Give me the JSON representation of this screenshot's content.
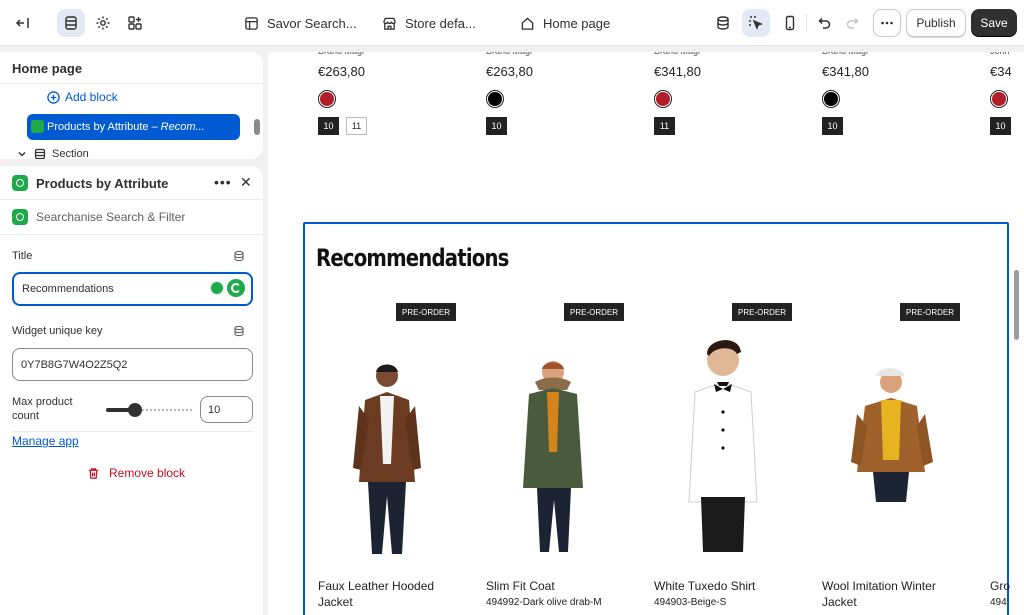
{
  "topbar": {
    "store_context": "Savor Search...",
    "theme_context": "Store defa...",
    "page_context": "Home page",
    "publish_label": "Publish",
    "save_label": "Save"
  },
  "tree": {
    "title": "Home page",
    "add_block": "Add block",
    "selected_block": "Products by Attribute",
    "selected_block_suffix": "– Recom...",
    "section_label": "Section"
  },
  "block_panel": {
    "title": "Products by Attribute",
    "app_name": "Searchanise Search & Filter",
    "title_label": "Title",
    "title_value": "Recommendations",
    "key_label": "Widget unique key",
    "key_value": "0Y7B8G7W4O2Z5Q2",
    "max_label": "Max product count",
    "max_value": "10",
    "max_level_fraction": 0.26,
    "manage_app": "Manage app",
    "remove_block": "Remove block"
  },
  "canvas": {
    "top_products": [
      {
        "brand": "Brand Magi",
        "price": "€263,80",
        "swatch": "#b1202a",
        "sizes": [
          {
            "label": "10",
            "style": "dark"
          },
          {
            "label": "11",
            "style": "light"
          }
        ]
      },
      {
        "brand": "Brand Magi",
        "price": "€263,80",
        "swatch": "#000000",
        "sizes": [
          {
            "label": "10",
            "style": "dark"
          }
        ]
      },
      {
        "brand": "Brand Magi",
        "price": "€341,80",
        "swatch": "#b1202a",
        "sizes": [
          {
            "label": "11",
            "style": "dark"
          }
        ]
      },
      {
        "brand": "Brand Magi",
        "price": "€341,80",
        "swatch": "#000000",
        "sizes": [
          {
            "label": "10",
            "style": "dark"
          }
        ]
      },
      {
        "brand": "John",
        "price": "€34",
        "swatch": "#b1202a",
        "sizes": [
          {
            "label": "10",
            "style": "dark"
          }
        ]
      }
    ],
    "recommendations_title": "Recommendations",
    "badge_label": "PRE-ORDER",
    "products": [
      {
        "name": "Faux Leather Hooded Jacket",
        "sku": ""
      },
      {
        "name": "Slim Fit Coat",
        "sku": "494992-Dark olive drab-M"
      },
      {
        "name": "White Tuxedo Shirt",
        "sku": "494903-Beige-S"
      },
      {
        "name": "Wool Imitation Winter Jacket",
        "sku": ""
      },
      {
        "name": "Gro",
        "sku": "494"
      }
    ]
  },
  "colors": {
    "accent": "#005bd3",
    "danger": "#c70a24",
    "app_green": "#1ea94a"
  }
}
